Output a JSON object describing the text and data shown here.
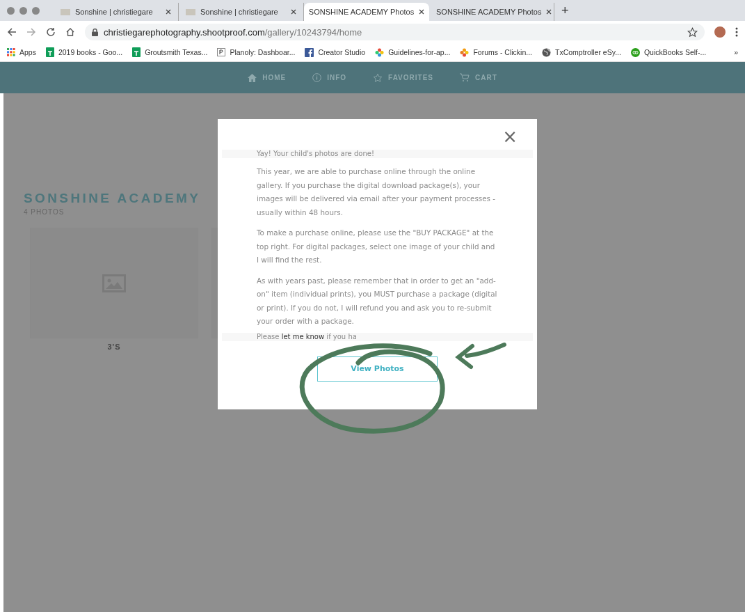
{
  "browser": {
    "tabs": [
      {
        "title": "Sonshine | christiegare",
        "selected": false,
        "favicon": true
      },
      {
        "title": "Sonshine | christiegare",
        "selected": false,
        "favicon": true
      },
      {
        "title": "SONSHINE ACADEMY Photos",
        "selected": true,
        "favicon": false
      },
      {
        "title": "SONSHINE ACADEMY Photos",
        "selected": false,
        "favicon": false
      }
    ],
    "new_tab": "+",
    "url": {
      "host": "christiegarephotography.shootproof.com",
      "path": "/gallery/10243794/home"
    },
    "bookmarks": [
      {
        "label": "Apps",
        "kind": "apps"
      },
      {
        "label": "2019 books - Goo...",
        "kind": "sheets"
      },
      {
        "label": "Groutsmith Texas...",
        "kind": "sheets"
      },
      {
        "label": "Planoly: Dashboar...",
        "kind": "p"
      },
      {
        "label": "Creator Studio",
        "kind": "facebook"
      },
      {
        "label": "Guidelines-for-ap...",
        "kind": "flower"
      },
      {
        "label": "Forums - Clickin...",
        "kind": "flower2"
      },
      {
        "label": "TxComptroller eSy...",
        "kind": "globe"
      },
      {
        "label": "QuickBooks Self-...",
        "kind": "qb"
      }
    ],
    "more_bookmarks": "»"
  },
  "site_nav": [
    {
      "label": "HOME",
      "kind": "home"
    },
    {
      "label": "INFO",
      "kind": "info"
    },
    {
      "label": "FAVORITES",
      "kind": "star"
    },
    {
      "label": "CART",
      "kind": "cart"
    }
  ],
  "gallery": {
    "title": "SONSHINE ACADEMY",
    "count": "4 PHOTOS",
    "albums": [
      {
        "label": "3'S"
      }
    ]
  },
  "modal": {
    "close": "×",
    "faded_top": "Yay! Your child's photos are done!",
    "paragraphs": [
      "This year, we are able to purchase online through the online gallery.  If you purchase the digital download package(s), your images will be delivered via email after your payment processes - usually within 48 hours.",
      "To make a purchase online, please use the \"BUY PACKAGE\" at the top right. For digital packages, select one image of your child and I will find the rest.",
      "As with years past, please remember that in order to get an \"add-on\" item (individual prints), you MUST purchase a package (digital or print).  If you do not, I will refund you and ask you to re-submit your order with a package."
    ],
    "faded_bottom": {
      "before": "Please ",
      "link": "let me know",
      "after": " if you ha"
    },
    "button": "View Photos"
  }
}
